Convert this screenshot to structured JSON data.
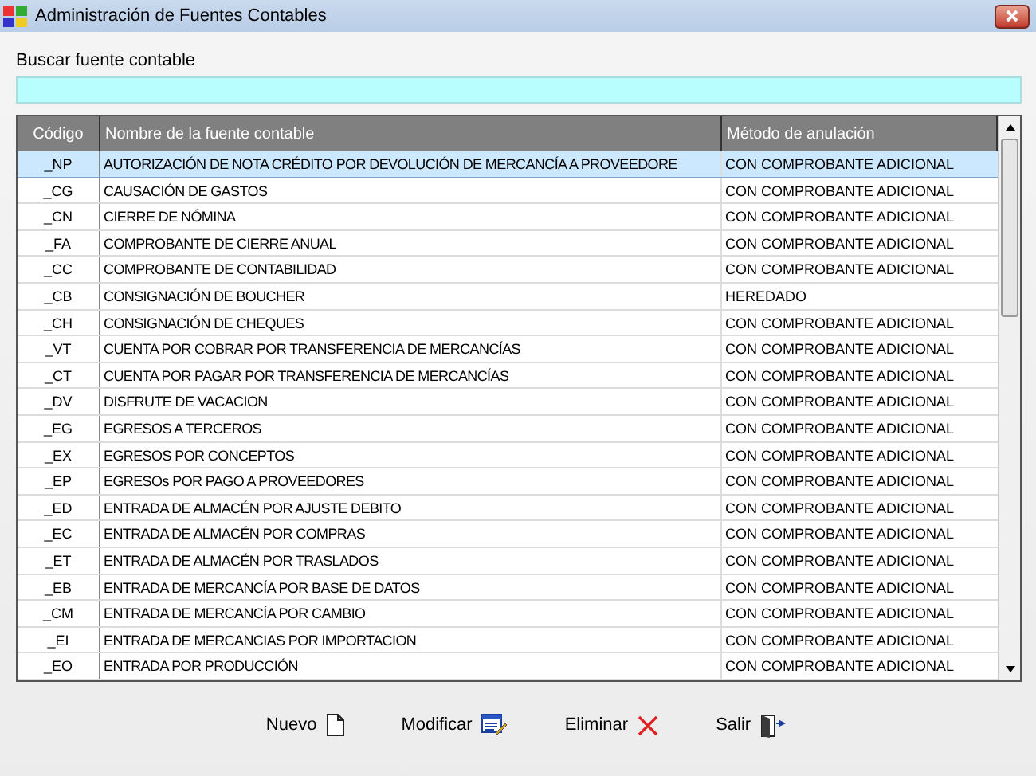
{
  "window": {
    "title": "Administración de Fuentes Contables"
  },
  "search": {
    "label": "Buscar fuente contable"
  },
  "table": {
    "columns": [
      "Código",
      "Nombre de la fuente contable",
      "Método de anulación"
    ],
    "rows": [
      {
        "code": "_NP",
        "name": "AUTORIZACIÓN DE NOTA CRÉDITO POR DEVOLUCIÓN DE MERCANCÍA A PROVEEDORE",
        "method": "CON COMPROBANTE ADICIONAL",
        "selected": true
      },
      {
        "code": "_CG",
        "name": "CAUSACIÓN DE GASTOS",
        "method": "CON COMPROBANTE ADICIONAL",
        "selected": false
      },
      {
        "code": "_CN",
        "name": "CIERRE DE NÓMINA",
        "method": "CON COMPROBANTE ADICIONAL",
        "selected": false
      },
      {
        "code": "_FA",
        "name": "COMPROBANTE DE CIERRE ANUAL",
        "method": "CON COMPROBANTE ADICIONAL",
        "selected": false
      },
      {
        "code": "_CC",
        "name": "COMPROBANTE DE CONTABILIDAD",
        "method": "CON COMPROBANTE ADICIONAL",
        "selected": false
      },
      {
        "code": "_CB",
        "name": "CONSIGNACIÓN DE BOUCHER",
        "method": "HEREDADO",
        "selected": false
      },
      {
        "code": "_CH",
        "name": "CONSIGNACIÓN DE CHEQUES",
        "method": "CON COMPROBANTE ADICIONAL",
        "selected": false
      },
      {
        "code": "_VT",
        "name": "CUENTA POR COBRAR POR TRANSFERENCIA DE MERCANCÍAS",
        "method": "CON COMPROBANTE ADICIONAL",
        "selected": false
      },
      {
        "code": "_CT",
        "name": "CUENTA POR PAGAR POR TRANSFERENCIA DE MERCANCÍAS",
        "method": "CON COMPROBANTE ADICIONAL",
        "selected": false
      },
      {
        "code": "_DV",
        "name": "DISFRUTE DE VACACION",
        "method": "CON COMPROBANTE ADICIONAL",
        "selected": false
      },
      {
        "code": "_EG",
        "name": "EGRESOS A TERCEROS",
        "method": "CON COMPROBANTE ADICIONAL",
        "selected": false
      },
      {
        "code": "_EX",
        "name": "EGRESOS POR CONCEPTOS",
        "method": "CON COMPROBANTE ADICIONAL",
        "selected": false
      },
      {
        "code": "_EP",
        "name": "EGRESOs POR PAGO A PROVEEDORES",
        "method": "CON COMPROBANTE ADICIONAL",
        "selected": false
      },
      {
        "code": "_ED",
        "name": "ENTRADA DE ALMACÉN POR AJUSTE DEBITO",
        "method": "CON COMPROBANTE ADICIONAL",
        "selected": false
      },
      {
        "code": "_EC",
        "name": "ENTRADA DE ALMACÉN POR COMPRAS",
        "method": "CON COMPROBANTE ADICIONAL",
        "selected": false
      },
      {
        "code": "_ET",
        "name": "ENTRADA DE ALMACÉN POR TRASLADOS",
        "method": "CON COMPROBANTE ADICIONAL",
        "selected": false
      },
      {
        "code": "_EB",
        "name": "ENTRADA DE MERCANCÍA POR BASE DE DATOS",
        "method": "CON COMPROBANTE ADICIONAL",
        "selected": false
      },
      {
        "code": "_CM",
        "name": "ENTRADA DE MERCANCÍA POR CAMBIO",
        "method": "CON COMPROBANTE ADICIONAL",
        "selected": false
      },
      {
        "code": "_EI",
        "name": "ENTRADA DE MERCANCIAS POR IMPORTACION",
        "method": "CON COMPROBANTE ADICIONAL",
        "selected": false
      },
      {
        "code": "_EO",
        "name": "ENTRADA POR PRODUCCIÓN",
        "method": "CON COMPROBANTE ADICIONAL",
        "selected": false
      }
    ]
  },
  "buttons": [
    {
      "kind": "new",
      "label": "Nuevo"
    },
    {
      "kind": "edit",
      "label": "Modificar"
    },
    {
      "kind": "delete",
      "label": "Eliminar"
    },
    {
      "kind": "exit",
      "label": "Salir"
    }
  ]
}
